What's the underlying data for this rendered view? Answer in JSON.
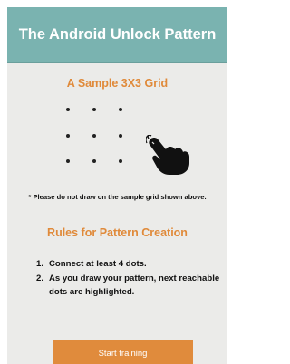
{
  "header": {
    "title": "The Android Unlock Pattern"
  },
  "sample": {
    "title": "A Sample 3X3 Grid",
    "hand_icon": "pointing-hand-icon",
    "note": "* Please do not draw on the sample grid shown above."
  },
  "rules": {
    "title": "Rules for Pattern Creation",
    "items": [
      {
        "num": "1.",
        "text": "Connect at least 4 dots."
      },
      {
        "num": "2.",
        "text": "As you draw your pattern, next reachable dots are highlighted."
      }
    ]
  },
  "actions": {
    "start_label": "Start training"
  },
  "colors": {
    "header_bg": "#7ab3b0",
    "accent_orange": "#e08a3a",
    "page_bg": "#ebebe9"
  }
}
